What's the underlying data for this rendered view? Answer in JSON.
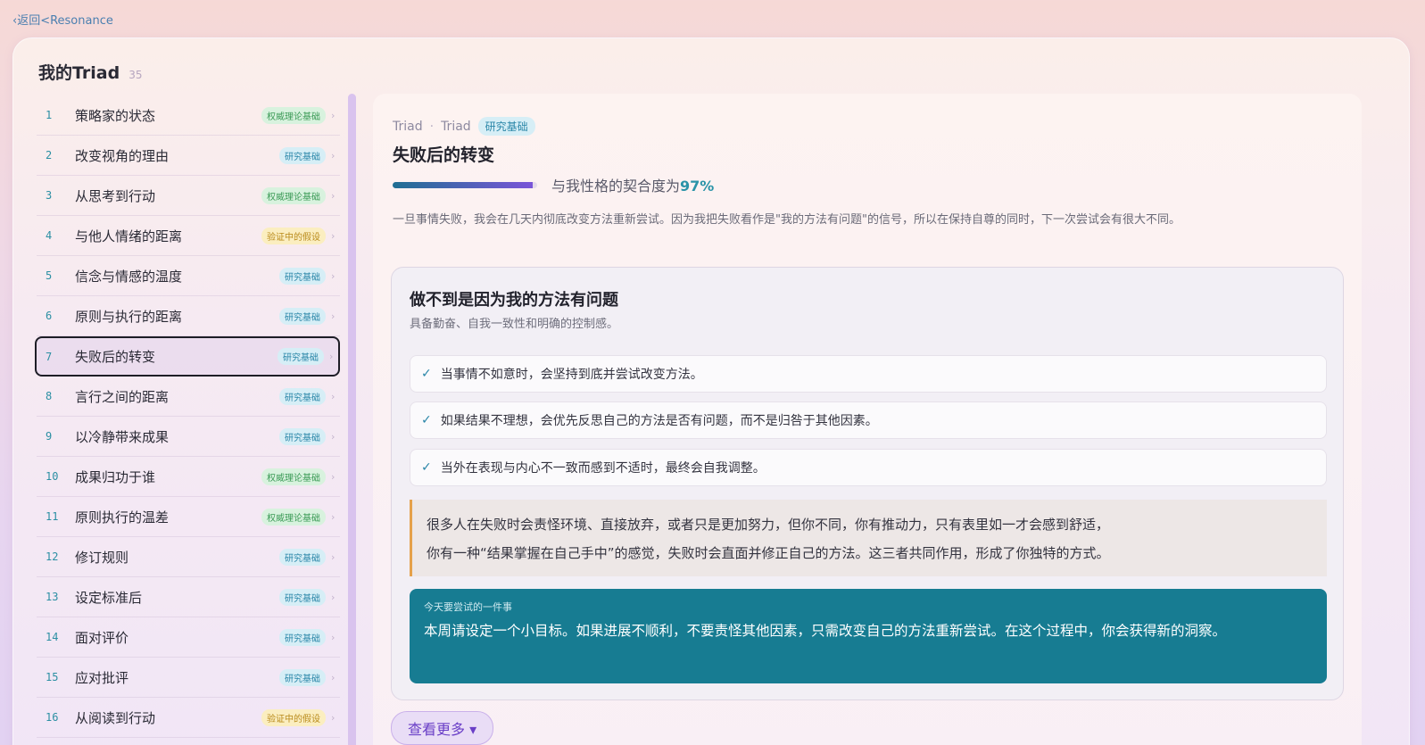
{
  "nav": {
    "back_label": "‹返回<Resonance"
  },
  "card": {
    "title": "我的Triad",
    "count": "35"
  },
  "sidebar": {
    "items": [
      {
        "num": "1",
        "label": "策略家的状态",
        "tag": "权威理论基础",
        "tag_type": "authority"
      },
      {
        "num": "2",
        "label": "改变视角的理由",
        "tag": "研究基础",
        "tag_type": "research"
      },
      {
        "num": "3",
        "label": "从思考到行动",
        "tag": "权威理论基础",
        "tag_type": "authority"
      },
      {
        "num": "4",
        "label": "与他人情绪的距离",
        "tag": "验证中的假设",
        "tag_type": "hypothesis"
      },
      {
        "num": "5",
        "label": "信念与情感的温度",
        "tag": "研究基础",
        "tag_type": "research"
      },
      {
        "num": "6",
        "label": "原则与执行的距离",
        "tag": "研究基础",
        "tag_type": "research"
      },
      {
        "num": "7",
        "label": "失败后的转变",
        "tag": "研究基础",
        "tag_type": "research",
        "active": true
      },
      {
        "num": "8",
        "label": "言行之间的距离",
        "tag": "研究基础",
        "tag_type": "research"
      },
      {
        "num": "9",
        "label": "以冷静带来成果",
        "tag": "研究基础",
        "tag_type": "research"
      },
      {
        "num": "10",
        "label": "成果归功于谁",
        "tag": "权威理论基础",
        "tag_type": "authority"
      },
      {
        "num": "11",
        "label": "原则执行的温差",
        "tag": "权威理论基础",
        "tag_type": "authority"
      },
      {
        "num": "12",
        "label": "修订规则",
        "tag": "研究基础",
        "tag_type": "research"
      },
      {
        "num": "13",
        "label": "设定标准后",
        "tag": "研究基础",
        "tag_type": "research"
      },
      {
        "num": "14",
        "label": "面对评价",
        "tag": "研究基础",
        "tag_type": "research"
      },
      {
        "num": "15",
        "label": "应对批评",
        "tag": "研究基础",
        "tag_type": "research"
      },
      {
        "num": "16",
        "label": "从阅读到行动",
        "tag": "验证中的假设",
        "tag_type": "hypothesis"
      }
    ]
  },
  "detail": {
    "crumb_1": "Triad",
    "crumb_sep": "·",
    "crumb_2": "Triad",
    "badge": "研究基础",
    "title": "失败后的转变",
    "match_label": "与我性格的契合度为",
    "match_pct": "97%",
    "match_value": 0.97,
    "intro": "一旦事情失败，我会在几天内彻底改变方法重新尝试。因为我把失败看作是\"我的方法有问题\"的信号，所以在保持自尊的同时，下一次尝试会有很大不同。",
    "box_title": "做不到是因为我的方法有问题",
    "box_sub": "具备勤奋、自我一致性和明确的控制感。",
    "checks": [
      "当事情不如意时，会坚持到底并尝试改变方法。",
      "如果结果不理想，会优先反思自己的方法是否有问题，而不是归咎于其他因素。",
      "当外在表现与内心不一致而感到不适时，最终会自我调整。"
    ],
    "quote_line1": "很多人在失败时会责怪环境、直接放弃，或者只是更加努力，但你不同，你有推动力，只有表里如一才会感到舒适，",
    "quote_line2": "你有一种“结果掌握在自己手中”的感觉，失败时会直面并修正自己的方法。这三者共同作用，形成了你独特的方式。",
    "tip_label": "今天要尝试的一件事",
    "tip_body": "本周请设定一个小目标。如果进展不顺利，不要责怪其他因素，只需改变自己的方法重新尝试。在这个过程中，你会获得新的洞察。",
    "more_label": "查看更多 ▾"
  },
  "colors": {
    "accent_teal": "#177c92",
    "accent_purple": "#6a3fc7",
    "tag_authority": "#3a9a55",
    "tag_research": "#2a86a8",
    "tag_hypothesis": "#b98a1a"
  }
}
